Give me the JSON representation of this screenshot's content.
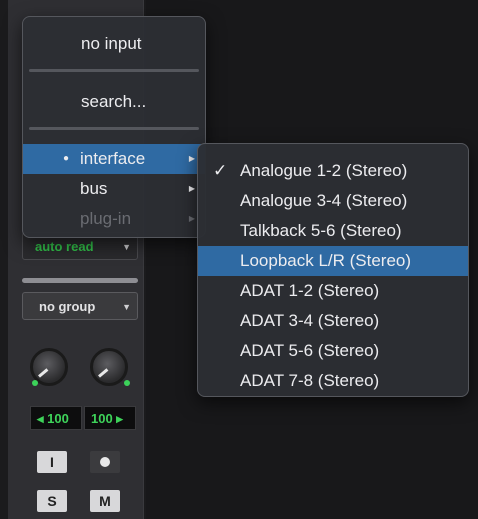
{
  "main_menu": {
    "no_input": "no input",
    "search": "search...",
    "interface": "interface",
    "bus": "bus",
    "plugin": "plug-in"
  },
  "submenu": {
    "items": [
      "Analogue 1-2 (Stereo)",
      "Analogue 3-4 (Stereo)",
      "Talkback 5-6 (Stereo)",
      "Loopback L/R (Stereo)",
      "ADAT 1-2 (Stereo)",
      "ADAT 3-4 (Stereo)",
      "ADAT 5-6 (Stereo)",
      "ADAT 7-8 (Stereo)"
    ],
    "checked_index": 0,
    "highlighted_index": 3,
    "check_mark": "✓"
  },
  "strip": {
    "automation": "auto read",
    "group": "no group",
    "pan_left": "◂ 100",
    "pan_right": "100 ▸",
    "input_button": "I",
    "solo": "S",
    "mute": "M"
  },
  "colors": {
    "highlight": "#2f6aa3",
    "accent_green": "#3ed35a"
  }
}
